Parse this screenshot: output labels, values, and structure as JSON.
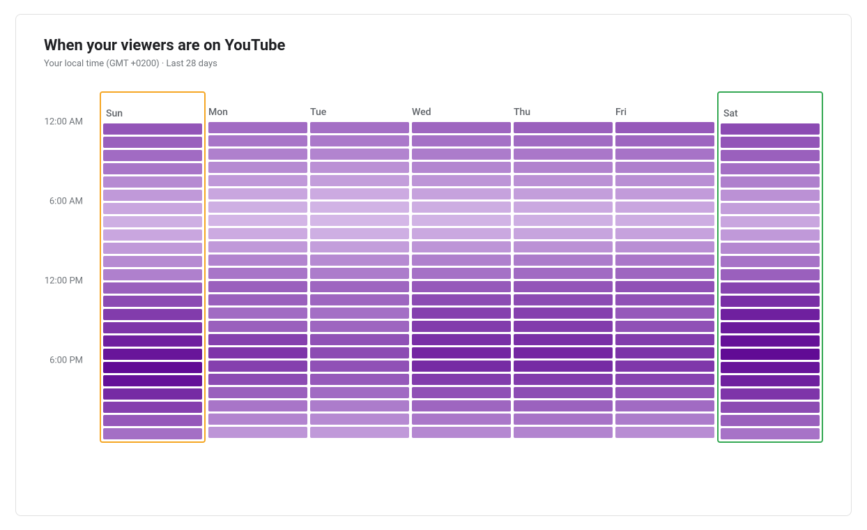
{
  "title": "When your viewers are on YouTube",
  "subtitle": "Your local time (GMT +0200) · Last 28 days",
  "yLabels": [
    "12:00 AM",
    "6:00 AM",
    "12:00 PM",
    "6:00 PM"
  ],
  "days": [
    {
      "label": "Sun",
      "highlight": "orange"
    },
    {
      "label": "Mon",
      "highlight": null
    },
    {
      "label": "Tue",
      "highlight": null
    },
    {
      "label": "Wed",
      "highlight": null
    },
    {
      "label": "Thu",
      "highlight": null
    },
    {
      "label": "Fri",
      "highlight": null
    },
    {
      "label": "Sat",
      "highlight": "green"
    }
  ],
  "heatData": {
    "Sun": [
      60,
      55,
      50,
      45,
      35,
      28,
      22,
      18,
      22,
      28,
      35,
      40,
      55,
      65,
      72,
      75,
      85,
      90,
      95,
      92,
      80,
      70,
      58,
      48
    ],
    "Mon": [
      50,
      45,
      40,
      35,
      28,
      22,
      18,
      15,
      20,
      28,
      38,
      45,
      55,
      55,
      50,
      55,
      70,
      75,
      70,
      65,
      55,
      45,
      38,
      30
    ],
    "Tue": [
      48,
      43,
      38,
      32,
      26,
      20,
      16,
      14,
      18,
      26,
      35,
      42,
      52,
      52,
      48,
      52,
      62,
      65,
      62,
      58,
      50,
      42,
      35,
      28
    ],
    "Wed": [
      52,
      47,
      42,
      37,
      30,
      24,
      19,
      16,
      21,
      30,
      40,
      47,
      58,
      65,
      70,
      72,
      78,
      82,
      80,
      72,
      62,
      52,
      44,
      36
    ],
    "Thu": [
      55,
      50,
      44,
      39,
      32,
      26,
      21,
      18,
      23,
      32,
      42,
      50,
      60,
      65,
      70,
      72,
      78,
      82,
      80,
      72,
      64,
      54,
      46,
      38
    ],
    "Fri": [
      58,
      52,
      46,
      40,
      33,
      27,
      22,
      19,
      24,
      33,
      44,
      52,
      62,
      62,
      58,
      62,
      72,
      76,
      74,
      68,
      60,
      50,
      42,
      34
    ],
    "Sat": [
      65,
      60,
      55,
      48,
      40,
      32,
      26,
      22,
      28,
      36,
      46,
      55,
      68,
      78,
      85,
      88,
      92,
      95,
      90,
      85,
      75,
      65,
      55,
      46
    ]
  },
  "colors": {
    "orange_border": "#f5a623",
    "green_border": "#34a853",
    "heat_max": "#6a0dad",
    "heat_min": "#e8d5f5"
  }
}
